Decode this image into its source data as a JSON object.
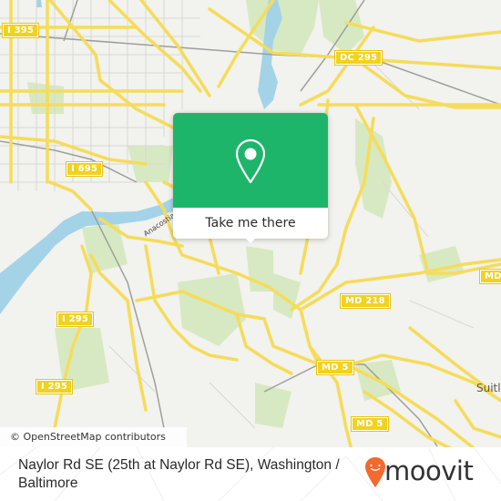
{
  "map": {
    "colors": {
      "background": "#f2f2ee",
      "water": "#9fd0e6",
      "park": "#cfe6b4",
      "road_major": "#f5dc5a",
      "road_minor": "#ffffff",
      "railway": "#9a9a9a",
      "shield_fill": "#f1d21e"
    },
    "road_shields": [
      {
        "label": "I 395"
      },
      {
        "label": "DC 295"
      },
      {
        "label": "I 695"
      },
      {
        "label": "I 295"
      },
      {
        "label": "I 295"
      },
      {
        "label": "MD 218"
      },
      {
        "label": "MD"
      },
      {
        "label": "MD 5"
      },
      {
        "label": "MD 5"
      }
    ],
    "place_labels": [
      {
        "label": "Suitl"
      }
    ],
    "water_labels": [
      {
        "label": "Anacostia"
      }
    ],
    "attribution": "© OpenStreetMap contributors"
  },
  "popup": {
    "icon": "map-pin-icon",
    "action_label": "Take me there",
    "accent_color": "#1db56a"
  },
  "footer": {
    "stop_title": "Naylor Rd SE (25th at Naylor Rd SE), Washington / Baltimore",
    "brand": {
      "name": "moovit",
      "logo_icon": "moovit-pin-icon",
      "color": "#f26a2e"
    }
  }
}
